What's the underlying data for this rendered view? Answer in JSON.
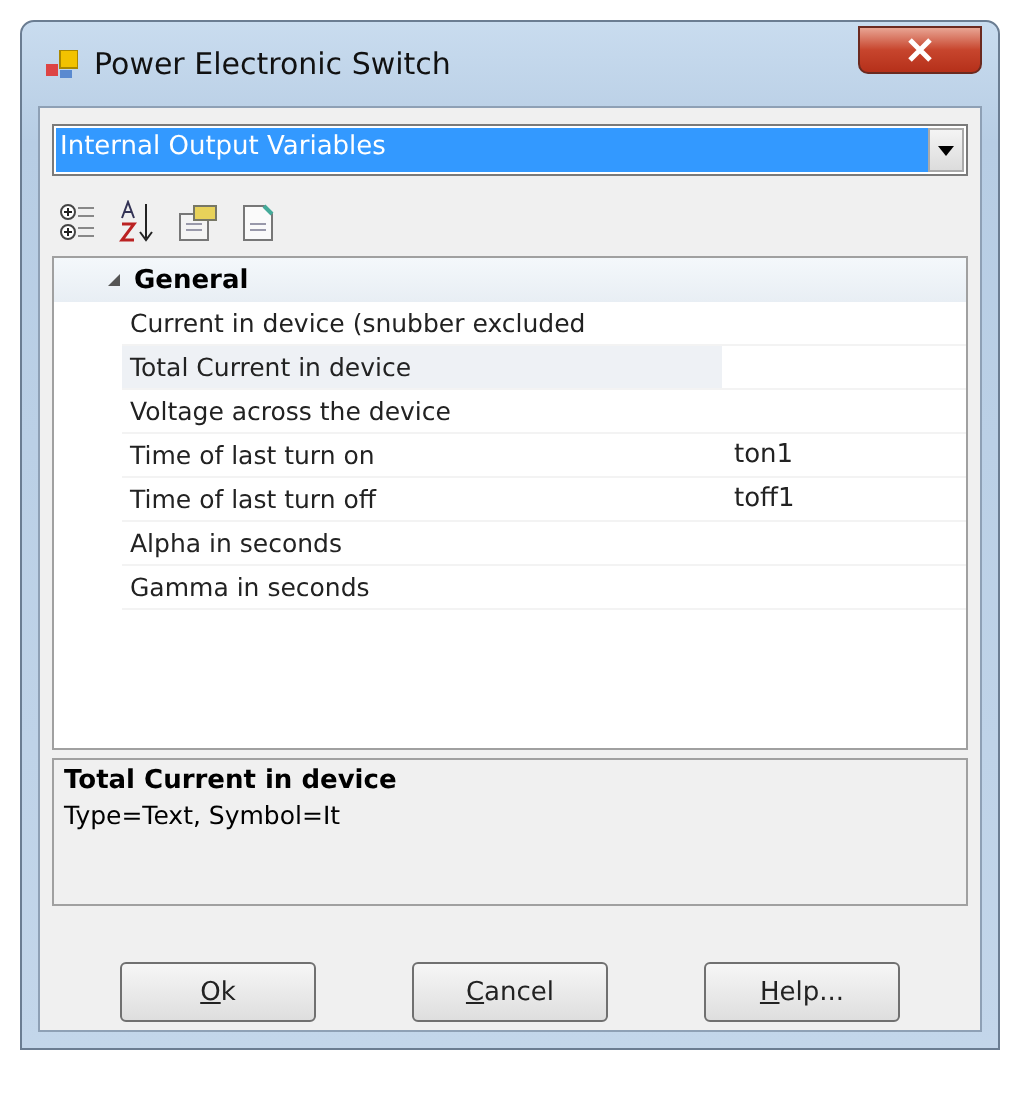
{
  "window": {
    "title": "Power Electronic Switch"
  },
  "dropdown": {
    "value": "Internal Output Variables"
  },
  "grid": {
    "categories": [
      {
        "name": "General",
        "expanded": true,
        "rows": [
          {
            "label": "Current in device (snubber excluded",
            "selected": false
          },
          {
            "label": "Total Current in device",
            "selected": true
          },
          {
            "label": "Voltage across the device",
            "selected": false
          },
          {
            "label": "Time of last turn on",
            "value": "ton1",
            "selected": false
          },
          {
            "label": "Time of last turn off",
            "value": "toff1",
            "selected": false
          },
          {
            "label": "Alpha in seconds",
            "selected": false
          },
          {
            "label": "Gamma in seconds",
            "selected": false
          }
        ]
      }
    ]
  },
  "description": {
    "title": "Total Current in device",
    "text": "Type=Text, Symbol=It"
  },
  "buttons": [
    {
      "mnemonic": "O",
      "rest": "k"
    },
    {
      "mnemonic": "C",
      "rest": "ancel"
    },
    {
      "mnemonic": "H",
      "rest": "elp..."
    }
  ]
}
